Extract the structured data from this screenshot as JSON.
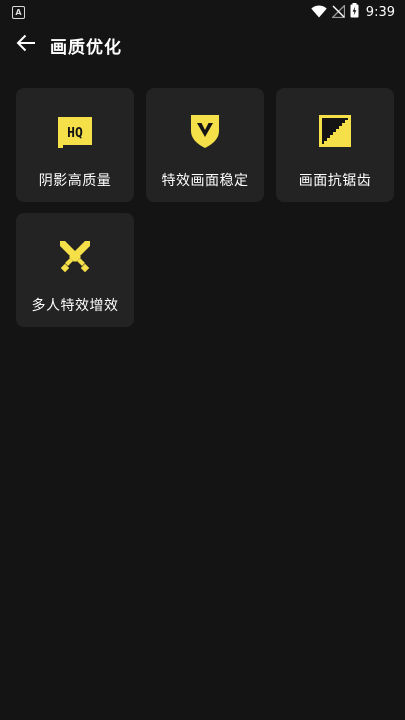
{
  "status_bar": {
    "notification_glyph": "A",
    "time": "9:39",
    "icons": [
      "wifi-icon",
      "signal-off-icon",
      "battery-charging-icon"
    ]
  },
  "header": {
    "back_icon": "arrow-left-icon",
    "title": "画质优化"
  },
  "accent_color": "#f5e04a",
  "options": [
    {
      "label": "阴影高质量",
      "icon": "hq-icon"
    },
    {
      "label": "特效画面稳定",
      "icon": "shield-v-icon"
    },
    {
      "label": "画面抗锯齿",
      "icon": "antialias-staircase-icon"
    },
    {
      "label": "多人特效增效",
      "icon": "crossed-swords-icon"
    }
  ]
}
